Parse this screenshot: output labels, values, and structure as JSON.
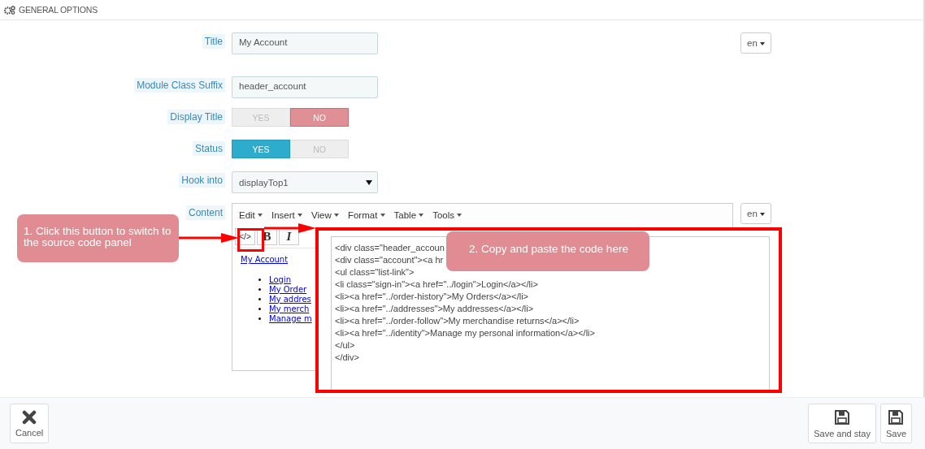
{
  "section_title": "GENERAL OPTIONS",
  "fields": [
    {
      "kind": "text",
      "label": "Title",
      "value": "My Account",
      "language": "en"
    },
    {
      "kind": "text",
      "label": "Module Class Suffix",
      "value": "header_account"
    },
    {
      "kind": "toggle",
      "label": "Display Title",
      "options": [
        {
          "label": "YES",
          "selected": false
        },
        {
          "label": "NO",
          "selected": true
        }
      ]
    },
    {
      "kind": "toggle",
      "label": "Status",
      "options": [
        {
          "label": "YES",
          "selected": true
        },
        {
          "label": "NO",
          "selected": false
        }
      ]
    },
    {
      "kind": "select",
      "label": "Hook into",
      "value": "displayTop1"
    },
    {
      "kind": "editor",
      "label": "Content",
      "language": "en"
    }
  ],
  "editor": {
    "menus": [
      "Edit",
      "Insert",
      "View",
      "Format",
      "Table",
      "Tools"
    ],
    "toolbar": [
      {
        "kind": "source",
        "label": "</>"
      },
      {
        "kind": "bold",
        "label": "B"
      },
      {
        "kind": "italic",
        "label": "I"
      }
    ],
    "preview_heading": "My Account",
    "preview_links": [
      "Login",
      "My Order",
      "My addres",
      "My merch",
      "Manage m"
    ]
  },
  "source_panel": {
    "lines": [
      "<div class=\"header_accoun",
      "<div class=\"account\"><a hr",
      "<ul class=\"list-link\">",
      "<li class=\"sign-in\"><a href=\"../login\">Login</a></li>",
      "<li><a href=\"../order-history\">My Orders</a></li>",
      "<li><a href=\"../addresses\">My addresses</a></li>",
      "<li><a href=\"../order-follow\">My merchandise returns</a></li>",
      "<li><a href=\"../identity\">Manage my personal information</a></li>",
      "</ul>",
      "</div>"
    ]
  },
  "callouts": [
    {
      "text": "1. Click this button to switch to the source code panel"
    },
    {
      "text": "2. Copy and paste the code here"
    }
  ],
  "footer": {
    "buttons": [
      {
        "kind": "cancel",
        "label": "Cancel"
      },
      {
        "kind": "save",
        "label": "Save and stay"
      },
      {
        "kind": "save",
        "label": "Save"
      }
    ]
  }
}
